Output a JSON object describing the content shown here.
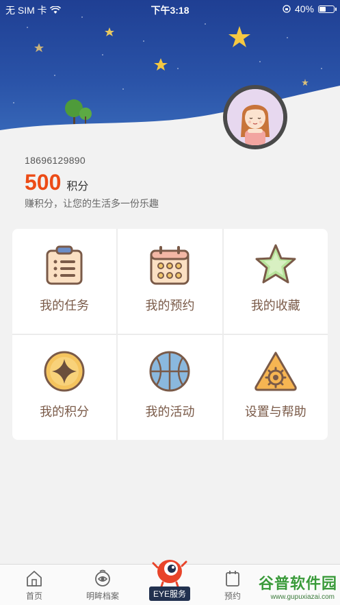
{
  "status_bar": {
    "carrier": "无 SIM 卡",
    "time": "下午3:18",
    "battery": "40%",
    "battery_level": 0.4
  },
  "profile": {
    "phone": "18696129890",
    "points": "500",
    "points_unit": "积分",
    "slogan": "赚积分，让您的生活多一份乐趣"
  },
  "grid": [
    {
      "label": "我的任务",
      "icon": "clipboard-icon"
    },
    {
      "label": "我的预约",
      "icon": "calendar-icon"
    },
    {
      "label": "我的收藏",
      "icon": "star-icon"
    },
    {
      "label": "我的积分",
      "icon": "points-coin-icon"
    },
    {
      "label": "我的活动",
      "icon": "basketball-icon"
    },
    {
      "label": "设置与帮助",
      "icon": "settings-gear-icon"
    }
  ],
  "tabbar": {
    "home": "首页",
    "eye_archive": "明眸档案",
    "eye_service": "EYE服务",
    "appointment": "预约",
    "watermark": "谷普软件园",
    "watermark_url": "www.gupuxiazai.com"
  },
  "colors": {
    "accent": "#ec4b16",
    "header_top": "#1f3f93",
    "label_brown": "#7a5a48",
    "tab_dark": "#22314f"
  }
}
